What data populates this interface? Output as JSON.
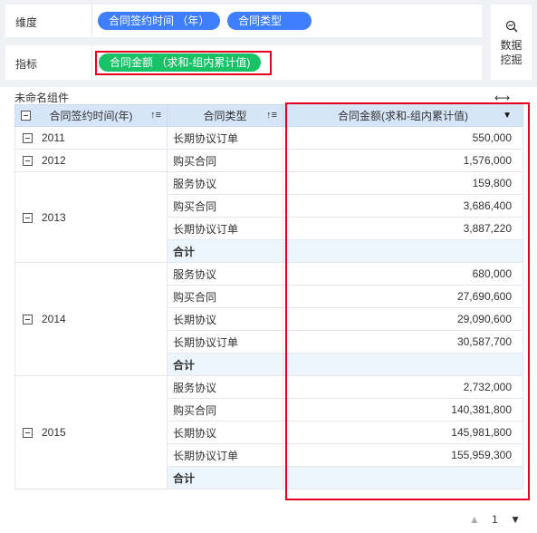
{
  "dimension_row": {
    "label": "维度",
    "pills": [
      "合同签约时间 （年）",
      "合同类型"
    ]
  },
  "metric_row": {
    "label": "指标",
    "pill": "合同金额 （求和-组内累计值)"
  },
  "mining_button": {
    "label": "数据挖掘",
    "icon": "search-chart-icon"
  },
  "component": {
    "title": "未命名组件",
    "expand_icon": "⟷"
  },
  "table": {
    "headers": [
      "合同签约时间(年)",
      "合同类型",
      "合同金额(求和-组内累计值)"
    ],
    "groups": [
      {
        "year": "2011",
        "rows": [
          {
            "type": "长期协议订单",
            "value": "550,000"
          }
        ]
      },
      {
        "year": "2012",
        "rows": [
          {
            "type": "购买合同",
            "value": "1,576,000"
          }
        ]
      },
      {
        "year": "2013",
        "rows": [
          {
            "type": "服务协议",
            "value": "159,800"
          },
          {
            "type": "购买合同",
            "value": "3,686,400"
          },
          {
            "type": "长期协议订单",
            "value": "3,887,220"
          },
          {
            "type": "合计",
            "value": ""
          }
        ]
      },
      {
        "year": "2014",
        "rows": [
          {
            "type": "服务协议",
            "value": "680,000"
          },
          {
            "type": "购买合同",
            "value": "27,690,600"
          },
          {
            "type": "长期协议",
            "value": "29,090,600"
          },
          {
            "type": "长期协议订单",
            "value": "30,587,700"
          },
          {
            "type": "合计",
            "value": ""
          }
        ]
      },
      {
        "year": "2015",
        "rows": [
          {
            "type": "服务协议",
            "value": "2,732,000"
          },
          {
            "type": "购买合同",
            "value": "140,381,800"
          },
          {
            "type": "长期协议",
            "value": "145,981,800"
          },
          {
            "type": "长期协议订单",
            "value": "155,959,300"
          },
          {
            "type": "合计",
            "value": ""
          }
        ]
      }
    ]
  },
  "pager": {
    "page": "1",
    "prev_icon": "▲",
    "next_icon": "▼"
  },
  "colors": {
    "pill_blue": "#3d7fff",
    "pill_green": "#18c266",
    "highlight_red": "#e6001f",
    "header_bg": "#d6e6f8"
  }
}
